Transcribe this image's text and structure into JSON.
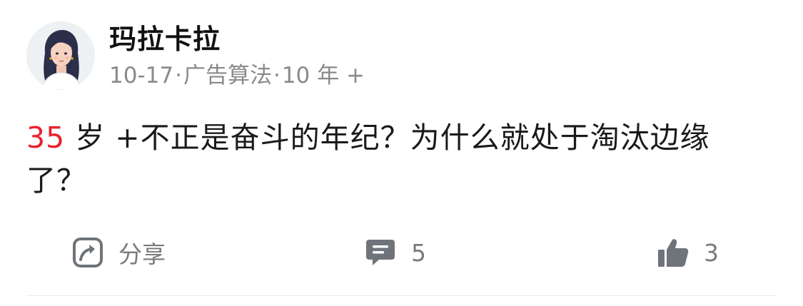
{
  "post": {
    "author": {
      "name": "玛拉卡拉"
    },
    "meta": {
      "date": "10-17",
      "separator": "·",
      "category": "广告算法",
      "separator2": "·",
      "experience": "10 年 +"
    },
    "content": {
      "highlight": "35",
      "text": " 岁 +不正是奋斗的年纪？为什么就处于淘汰边缘了？"
    },
    "actions": {
      "share_label": "分享",
      "comment_count": "5",
      "like_count": "3"
    },
    "icons": {
      "share": "share-icon",
      "comment": "comment-icon",
      "like": "thumbs-up-icon"
    },
    "colors": {
      "highlight": "#e8212c",
      "meta": "#8a8a8a",
      "icon": "#6f737a"
    }
  }
}
